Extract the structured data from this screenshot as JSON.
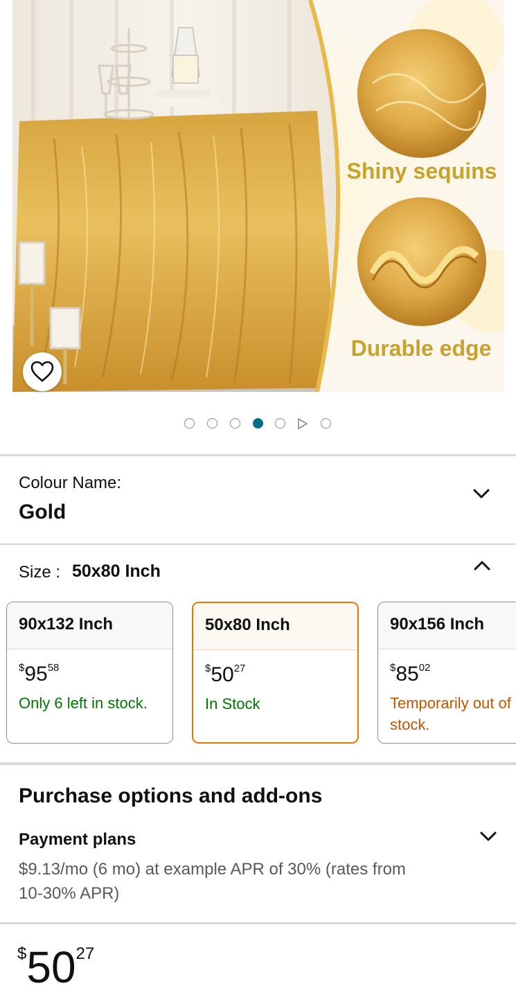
{
  "hero": {
    "callouts": [
      "Shiny sequins",
      "Durable edge"
    ],
    "icons": {
      "wishlist": "heart-outline-icon"
    }
  },
  "carousel": {
    "count": 7,
    "active_index": 3,
    "video_index": 5
  },
  "colour": {
    "label": "Colour Name:",
    "value": "Gold",
    "icon": "chevron-down-icon"
  },
  "size": {
    "label": "Size :",
    "value": "50x80 Inch",
    "icon": "chevron-up-icon"
  },
  "size_options": [
    {
      "name": "90x132 Inch",
      "currency": "$",
      "whole": "95",
      "fraction": "58",
      "availability": "Only 6 left in stock.",
      "status": "low"
    },
    {
      "name": "50x80 Inch",
      "currency": "$",
      "whole": "50",
      "fraction": "27",
      "availability": "In Stock",
      "status": "in"
    },
    {
      "name": "90x156 Inch",
      "currency": "$",
      "whole": "85",
      "fraction": "02",
      "availability": "Temporarily out of stock.",
      "status": "out"
    }
  ],
  "purchase": {
    "title": "Purchase options and add-ons",
    "payment_title": "Payment plans",
    "payment_desc": "$9.13/mo (6 mo) at example APR of 30% (rates from 10-30% APR)"
  },
  "price": {
    "currency": "$",
    "whole": "50",
    "fraction": "27"
  },
  "colors": {
    "accent": "#007185",
    "selected_border": "#e77600",
    "in_stock": "#007600",
    "out_of_stock": "#c45500",
    "callout_text": "#c9a227"
  }
}
